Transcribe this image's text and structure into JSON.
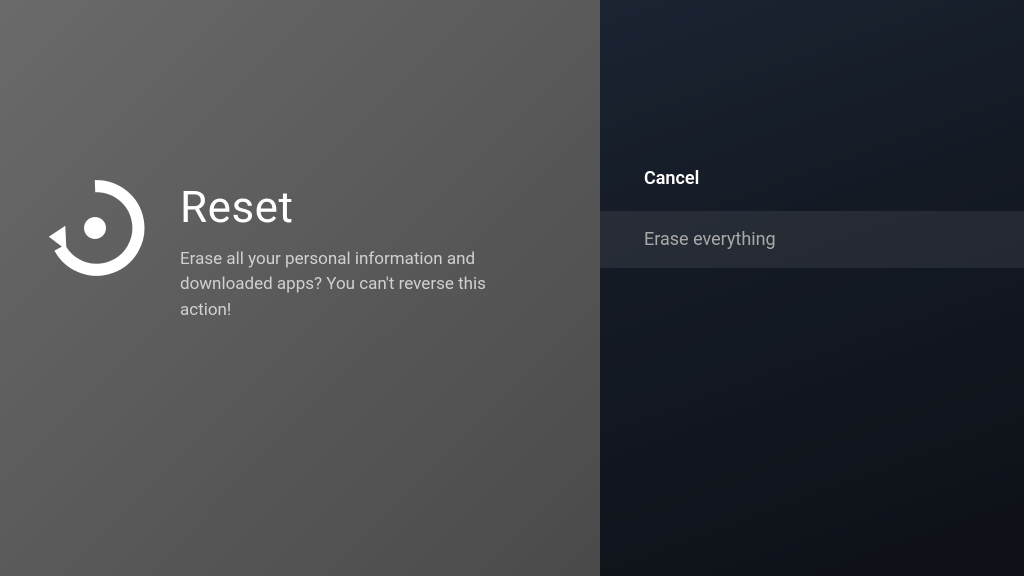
{
  "left": {
    "title": "Reset",
    "description": "Erase all your personal information and downloaded apps? You can't reverse this action!"
  },
  "options": {
    "cancel": "Cancel",
    "erase": "Erase everything"
  }
}
